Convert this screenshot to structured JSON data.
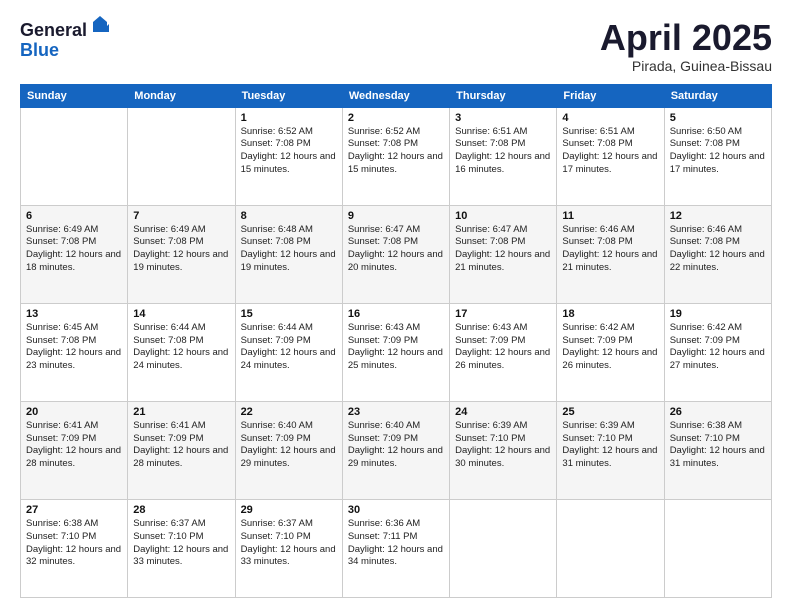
{
  "header": {
    "logo_general": "General",
    "logo_blue": "Blue",
    "month_title": "April 2025",
    "location": "Pirada, Guinea-Bissau"
  },
  "days_of_week": [
    "Sunday",
    "Monday",
    "Tuesday",
    "Wednesday",
    "Thursday",
    "Friday",
    "Saturday"
  ],
  "weeks": [
    [
      {
        "day": "",
        "sunrise": "",
        "sunset": "",
        "daylight": ""
      },
      {
        "day": "",
        "sunrise": "",
        "sunset": "",
        "daylight": ""
      },
      {
        "day": "1",
        "sunrise": "Sunrise: 6:52 AM",
        "sunset": "Sunset: 7:08 PM",
        "daylight": "Daylight: 12 hours and 15 minutes."
      },
      {
        "day": "2",
        "sunrise": "Sunrise: 6:52 AM",
        "sunset": "Sunset: 7:08 PM",
        "daylight": "Daylight: 12 hours and 15 minutes."
      },
      {
        "day": "3",
        "sunrise": "Sunrise: 6:51 AM",
        "sunset": "Sunset: 7:08 PM",
        "daylight": "Daylight: 12 hours and 16 minutes."
      },
      {
        "day": "4",
        "sunrise": "Sunrise: 6:51 AM",
        "sunset": "Sunset: 7:08 PM",
        "daylight": "Daylight: 12 hours and 17 minutes."
      },
      {
        "day": "5",
        "sunrise": "Sunrise: 6:50 AM",
        "sunset": "Sunset: 7:08 PM",
        "daylight": "Daylight: 12 hours and 17 minutes."
      }
    ],
    [
      {
        "day": "6",
        "sunrise": "Sunrise: 6:49 AM",
        "sunset": "Sunset: 7:08 PM",
        "daylight": "Daylight: 12 hours and 18 minutes."
      },
      {
        "day": "7",
        "sunrise": "Sunrise: 6:49 AM",
        "sunset": "Sunset: 7:08 PM",
        "daylight": "Daylight: 12 hours and 19 minutes."
      },
      {
        "day": "8",
        "sunrise": "Sunrise: 6:48 AM",
        "sunset": "Sunset: 7:08 PM",
        "daylight": "Daylight: 12 hours and 19 minutes."
      },
      {
        "day": "9",
        "sunrise": "Sunrise: 6:47 AM",
        "sunset": "Sunset: 7:08 PM",
        "daylight": "Daylight: 12 hours and 20 minutes."
      },
      {
        "day": "10",
        "sunrise": "Sunrise: 6:47 AM",
        "sunset": "Sunset: 7:08 PM",
        "daylight": "Daylight: 12 hours and 21 minutes."
      },
      {
        "day": "11",
        "sunrise": "Sunrise: 6:46 AM",
        "sunset": "Sunset: 7:08 PM",
        "daylight": "Daylight: 12 hours and 21 minutes."
      },
      {
        "day": "12",
        "sunrise": "Sunrise: 6:46 AM",
        "sunset": "Sunset: 7:08 PM",
        "daylight": "Daylight: 12 hours and 22 minutes."
      }
    ],
    [
      {
        "day": "13",
        "sunrise": "Sunrise: 6:45 AM",
        "sunset": "Sunset: 7:08 PM",
        "daylight": "Daylight: 12 hours and 23 minutes."
      },
      {
        "day": "14",
        "sunrise": "Sunrise: 6:44 AM",
        "sunset": "Sunset: 7:08 PM",
        "daylight": "Daylight: 12 hours and 24 minutes."
      },
      {
        "day": "15",
        "sunrise": "Sunrise: 6:44 AM",
        "sunset": "Sunset: 7:09 PM",
        "daylight": "Daylight: 12 hours and 24 minutes."
      },
      {
        "day": "16",
        "sunrise": "Sunrise: 6:43 AM",
        "sunset": "Sunset: 7:09 PM",
        "daylight": "Daylight: 12 hours and 25 minutes."
      },
      {
        "day": "17",
        "sunrise": "Sunrise: 6:43 AM",
        "sunset": "Sunset: 7:09 PM",
        "daylight": "Daylight: 12 hours and 26 minutes."
      },
      {
        "day": "18",
        "sunrise": "Sunrise: 6:42 AM",
        "sunset": "Sunset: 7:09 PM",
        "daylight": "Daylight: 12 hours and 26 minutes."
      },
      {
        "day": "19",
        "sunrise": "Sunrise: 6:42 AM",
        "sunset": "Sunset: 7:09 PM",
        "daylight": "Daylight: 12 hours and 27 minutes."
      }
    ],
    [
      {
        "day": "20",
        "sunrise": "Sunrise: 6:41 AM",
        "sunset": "Sunset: 7:09 PM",
        "daylight": "Daylight: 12 hours and 28 minutes."
      },
      {
        "day": "21",
        "sunrise": "Sunrise: 6:41 AM",
        "sunset": "Sunset: 7:09 PM",
        "daylight": "Daylight: 12 hours and 28 minutes."
      },
      {
        "day": "22",
        "sunrise": "Sunrise: 6:40 AM",
        "sunset": "Sunset: 7:09 PM",
        "daylight": "Daylight: 12 hours and 29 minutes."
      },
      {
        "day": "23",
        "sunrise": "Sunrise: 6:40 AM",
        "sunset": "Sunset: 7:09 PM",
        "daylight": "Daylight: 12 hours and 29 minutes."
      },
      {
        "day": "24",
        "sunrise": "Sunrise: 6:39 AM",
        "sunset": "Sunset: 7:10 PM",
        "daylight": "Daylight: 12 hours and 30 minutes."
      },
      {
        "day": "25",
        "sunrise": "Sunrise: 6:39 AM",
        "sunset": "Sunset: 7:10 PM",
        "daylight": "Daylight: 12 hours and 31 minutes."
      },
      {
        "day": "26",
        "sunrise": "Sunrise: 6:38 AM",
        "sunset": "Sunset: 7:10 PM",
        "daylight": "Daylight: 12 hours and 31 minutes."
      }
    ],
    [
      {
        "day": "27",
        "sunrise": "Sunrise: 6:38 AM",
        "sunset": "Sunset: 7:10 PM",
        "daylight": "Daylight: 12 hours and 32 minutes."
      },
      {
        "day": "28",
        "sunrise": "Sunrise: 6:37 AM",
        "sunset": "Sunset: 7:10 PM",
        "daylight": "Daylight: 12 hours and 33 minutes."
      },
      {
        "day": "29",
        "sunrise": "Sunrise: 6:37 AM",
        "sunset": "Sunset: 7:10 PM",
        "daylight": "Daylight: 12 hours and 33 minutes."
      },
      {
        "day": "30",
        "sunrise": "Sunrise: 6:36 AM",
        "sunset": "Sunset: 7:11 PM",
        "daylight": "Daylight: 12 hours and 34 minutes."
      },
      {
        "day": "",
        "sunrise": "",
        "sunset": "",
        "daylight": ""
      },
      {
        "day": "",
        "sunrise": "",
        "sunset": "",
        "daylight": ""
      },
      {
        "day": "",
        "sunrise": "",
        "sunset": "",
        "daylight": ""
      }
    ]
  ]
}
